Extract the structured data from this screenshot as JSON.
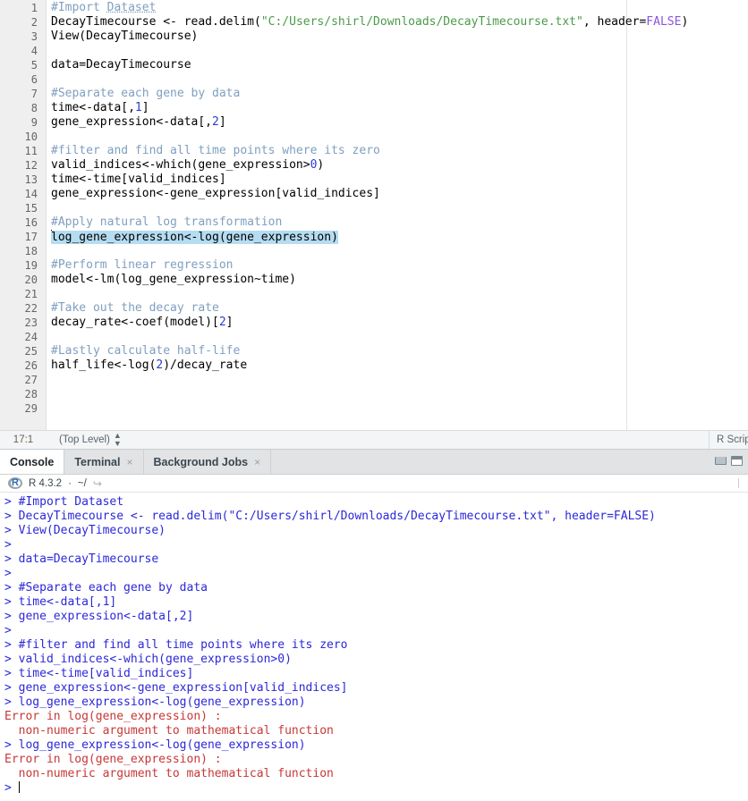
{
  "editor": {
    "name": "source-editor",
    "first_line": 1,
    "total_lines": 29,
    "selected_line": 17,
    "lines": [
      {
        "n": 1,
        "segments": [
          {
            "t": "#Import ",
            "c": "cmt"
          },
          {
            "t": "Dataset",
            "c": "cmt-u"
          }
        ]
      },
      {
        "n": 2,
        "segments": [
          {
            "t": "DecayTimecourse <- read.delim(",
            "c": "op"
          },
          {
            "t": "\"C:/Users/shirl/Downloads/DecayTimecourse.txt\"",
            "c": "str"
          },
          {
            "t": ", header=",
            "c": "op"
          },
          {
            "t": "FALSE",
            "c": "kw"
          },
          {
            "t": ")",
            "c": "op"
          }
        ]
      },
      {
        "n": 3,
        "segments": [
          {
            "t": "View(DecayTimecourse)",
            "c": "op"
          }
        ]
      },
      {
        "n": 4,
        "segments": []
      },
      {
        "n": 5,
        "segments": [
          {
            "t": "data=DecayTimecourse",
            "c": "op"
          }
        ]
      },
      {
        "n": 6,
        "segments": []
      },
      {
        "n": 7,
        "segments": [
          {
            "t": "#Separate each gene by data",
            "c": "cmt"
          }
        ]
      },
      {
        "n": 8,
        "segments": [
          {
            "t": "time<-data[,",
            "c": "op"
          },
          {
            "t": "1",
            "c": "num"
          },
          {
            "t": "]",
            "c": "op"
          }
        ]
      },
      {
        "n": 9,
        "segments": [
          {
            "t": "gene_expression<-data[,",
            "c": "op"
          },
          {
            "t": "2",
            "c": "num"
          },
          {
            "t": "]",
            "c": "op"
          }
        ]
      },
      {
        "n": 10,
        "segments": []
      },
      {
        "n": 11,
        "segments": [
          {
            "t": "#filter and find all time points where its zero",
            "c": "cmt"
          }
        ]
      },
      {
        "n": 12,
        "segments": [
          {
            "t": "valid_indices<-which(gene_expression>",
            "c": "op"
          },
          {
            "t": "0",
            "c": "num"
          },
          {
            "t": ")",
            "c": "op"
          }
        ]
      },
      {
        "n": 13,
        "segments": [
          {
            "t": "time<-time[valid_indices]",
            "c": "op"
          }
        ]
      },
      {
        "n": 14,
        "segments": [
          {
            "t": "gene_expression<-gene_expression[valid_indices]",
            "c": "op"
          }
        ]
      },
      {
        "n": 15,
        "segments": []
      },
      {
        "n": 16,
        "segments": [
          {
            "t": "#Apply natural log transformation",
            "c": "cmt"
          }
        ]
      },
      {
        "n": 17,
        "segments": [
          {
            "t": "log_gene_expression<-log(gene_expression)",
            "c": "op"
          }
        ],
        "selected": true,
        "caret": true
      },
      {
        "n": 18,
        "segments": []
      },
      {
        "n": 19,
        "segments": [
          {
            "t": "#Perform linear regression",
            "c": "cmt"
          }
        ]
      },
      {
        "n": 20,
        "segments": [
          {
            "t": "model<-lm(log_gene_expression~time)",
            "c": "op"
          }
        ]
      },
      {
        "n": 21,
        "segments": []
      },
      {
        "n": 22,
        "segments": [
          {
            "t": "#Take out the decay rate",
            "c": "cmt"
          }
        ]
      },
      {
        "n": 23,
        "segments": [
          {
            "t": "decay_rate<-coef(model)[",
            "c": "op"
          },
          {
            "t": "2",
            "c": "num"
          },
          {
            "t": "]",
            "c": "op"
          }
        ]
      },
      {
        "n": 24,
        "segments": []
      },
      {
        "n": 25,
        "segments": [
          {
            "t": "#Lastly calculate half-life",
            "c": "cmt"
          }
        ]
      },
      {
        "n": 26,
        "segments": [
          {
            "t": "half_life<-log(",
            "c": "op"
          },
          {
            "t": "2",
            "c": "num"
          },
          {
            "t": ")/decay_rate",
            "c": "op"
          }
        ]
      },
      {
        "n": 27,
        "segments": []
      },
      {
        "n": 28,
        "segments": []
      },
      {
        "n": 29,
        "segments": []
      }
    ]
  },
  "editor_status": {
    "cursor_position": "17:1",
    "scope": "(Top Level)",
    "scope_chevron_icon": "up-down-chevron-icon",
    "doc_type": "R Script"
  },
  "console_panel": {
    "tabs": [
      {
        "label": "Console",
        "active": true,
        "closable": false
      },
      {
        "label": "Terminal",
        "active": false,
        "closable": true
      },
      {
        "label": "Background Jobs",
        "active": false,
        "closable": true
      }
    ],
    "close_glyph": "×",
    "window_controls": [
      {
        "name": "minimize-icon"
      },
      {
        "name": "maximize-icon"
      }
    ],
    "header": {
      "logo_icon": "r-logo-icon",
      "logo_letter": "R",
      "version": "R 4.3.2",
      "separator": "·",
      "working_dir": "~/",
      "share_icon": "share-arrow-icon",
      "share_glyph": "↪"
    },
    "output_lines": [
      {
        "type": "input",
        "text": "> #Import Dataset"
      },
      {
        "type": "input",
        "text": "> DecayTimecourse <- read.delim(\"C:/Users/shirl/Downloads/DecayTimecourse.txt\", header=FALSE)"
      },
      {
        "type": "input",
        "text": "> View(DecayTimecourse)"
      },
      {
        "type": "input",
        "text": "> "
      },
      {
        "type": "input",
        "text": "> data=DecayTimecourse"
      },
      {
        "type": "input",
        "text": "> "
      },
      {
        "type": "input",
        "text": "> #Separate each gene by data"
      },
      {
        "type": "input",
        "text": "> time<-data[,1]"
      },
      {
        "type": "input",
        "text": "> gene_expression<-data[,2]"
      },
      {
        "type": "input",
        "text": "> "
      },
      {
        "type": "input",
        "text": "> #filter and find all time points where its zero"
      },
      {
        "type": "input",
        "text": "> valid_indices<-which(gene_expression>0)"
      },
      {
        "type": "input",
        "text": "> time<-time[valid_indices]"
      },
      {
        "type": "input",
        "text": "> gene_expression<-gene_expression[valid_indices]"
      },
      {
        "type": "input",
        "text": "> log_gene_expression<-log(gene_expression)"
      },
      {
        "type": "error",
        "text": "Error in log(gene_expression) : "
      },
      {
        "type": "error",
        "text": "  non-numeric argument to mathematical function"
      },
      {
        "type": "input",
        "text": "> log_gene_expression<-log(gene_expression)"
      },
      {
        "type": "error",
        "text": "Error in log(gene_expression) : "
      },
      {
        "type": "error",
        "text": "  non-numeric argument to mathematical function"
      },
      {
        "type": "prompt",
        "text": "> "
      }
    ]
  },
  "colors": {
    "editor_bg": "#ffffff",
    "gutter_bg": "#efefef",
    "selection": "#b5dcf0",
    "comment": "#7f9fbf",
    "string": "#4a9a4a",
    "number": "#2b3bd0",
    "keyword": "#8855dd",
    "console_input": "#2b28d8",
    "console_error": "#c83737",
    "tabbar_bg": "#e1e3e4",
    "statusbar_bg": "#f3f5f6"
  }
}
